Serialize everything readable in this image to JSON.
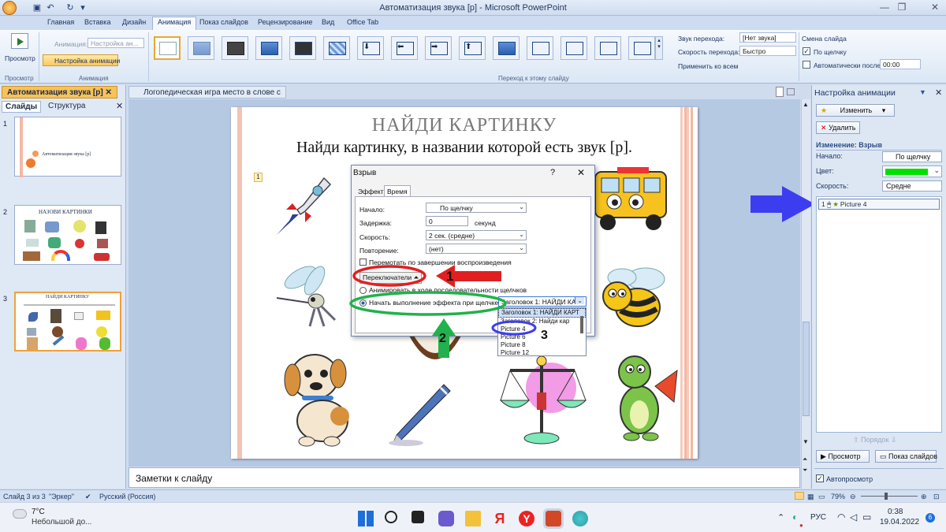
{
  "window": {
    "title": "Автоматизация звука [р] - Microsoft PowerPoint"
  },
  "ribbon_tabs": [
    "Главная",
    "Вставка",
    "Дизайн",
    "Анимация",
    "Показ слайдов",
    "Рецензирование",
    "Вид",
    "Office Tab"
  ],
  "ribbon": {
    "preview_label": "Просмотр",
    "animation_label": "Анимация:",
    "animation_value": "Настройка ан...",
    "custom_animation_label": "Настройка анимации",
    "group_preview": "Просмотр",
    "group_animation": "Анимация",
    "group_transition": "Переход к этому слайду",
    "sound_label": "Звук перехода:",
    "sound_value": "[Нет звука]",
    "speed_label": "Скорость перехода:",
    "speed_value": "Быстро",
    "apply_all": "Применить ко всем",
    "slide_change_label": "Смена слайда",
    "on_click_label": "По щелчку",
    "auto_after_label": "Автоматически после:",
    "auto_after_value": "00:00"
  },
  "left_pane": {
    "tab_slides": "Слайды",
    "tab_outline": "Структура",
    "slides": [
      {
        "num": "1",
        "caption": "Автоматизация звука [р]"
      },
      {
        "num": "2",
        "caption": "НАЗОВИ КАРТИНКИ"
      },
      {
        "num": "3",
        "caption": "НАЙДИ КАРТИНКУ"
      }
    ]
  },
  "doc_tabs": [
    "Автоматизация звука [р]",
    "Логопедическая игра место в слове с"
  ],
  "slide": {
    "title": "НАЙДИ КАРТИНКУ",
    "subtitle": "Найди картинку, в названии которой есть звук [р].",
    "anim_marker": "1"
  },
  "notes_placeholder": "Заметки к слайду",
  "dialog": {
    "title": "Взрыв",
    "tab_effect": "Эффект",
    "tab_timing": "Время",
    "start_label": "Начало:",
    "start_value": "По щелчку",
    "delay_label": "Задержка:",
    "delay_value": "0",
    "delay_unit": "секунд",
    "speed_label": "Скорость:",
    "speed_value": "2 сек. (средне)",
    "repeat_label": "Повторение:",
    "repeat_value": "(нет)",
    "rewind_label": "Перемотать по завершении воспроизведения",
    "triggers_label": "Переключатели",
    "radio_sequence": "Анимировать в ходе последовательности щелчков",
    "radio_onclick": "Начать выполнение эффекта при щелчке",
    "trigger_value": "Заголовок 1: НАЙДИ КАРТ",
    "list_items": [
      "Заголовок 1: НАЙДИ КАРТ",
      "Заголовок 2: Найди кар",
      "Picture 4",
      "Picture 6",
      "Picture 8",
      "Picture 12"
    ],
    "help": "?",
    "close": "✕"
  },
  "annotations": [
    "1",
    "2",
    "3"
  ],
  "task_pane": {
    "title": "Настройка анимации",
    "change_button": "Изменить",
    "delete_button": "Удалить",
    "effect_header": "Изменение: Взрыв",
    "start_label": "Начало:",
    "start_value": "По щелчку",
    "color_label": "Цвет:",
    "color_value": "#00e000",
    "speed_label": "Скорость:",
    "speed_value": "Средне",
    "list_item_num": "1",
    "list_item_name": "Picture 4",
    "order_label": "Порядок",
    "preview_button": "Просмотр",
    "slideshow_button": "Показ слайдов",
    "autopreview_label": "Автопросмотр"
  },
  "status": {
    "slide_info": "Слайд 3 из 3",
    "theme": "\"Эркер\"",
    "language": "Русский (Россия)",
    "zoom": "79%"
  },
  "taskbar": {
    "weather_temp": "7°C",
    "weather_desc": "Небольшой до...",
    "lang": "РУС",
    "time": "0:38",
    "date": "19.04.2022",
    "notifications": "6"
  },
  "colors": {
    "annotation_red": "#e02020",
    "annotation_green": "#22b14c",
    "annotation_blue": "#3d3df0",
    "accent": "#2b579a"
  }
}
